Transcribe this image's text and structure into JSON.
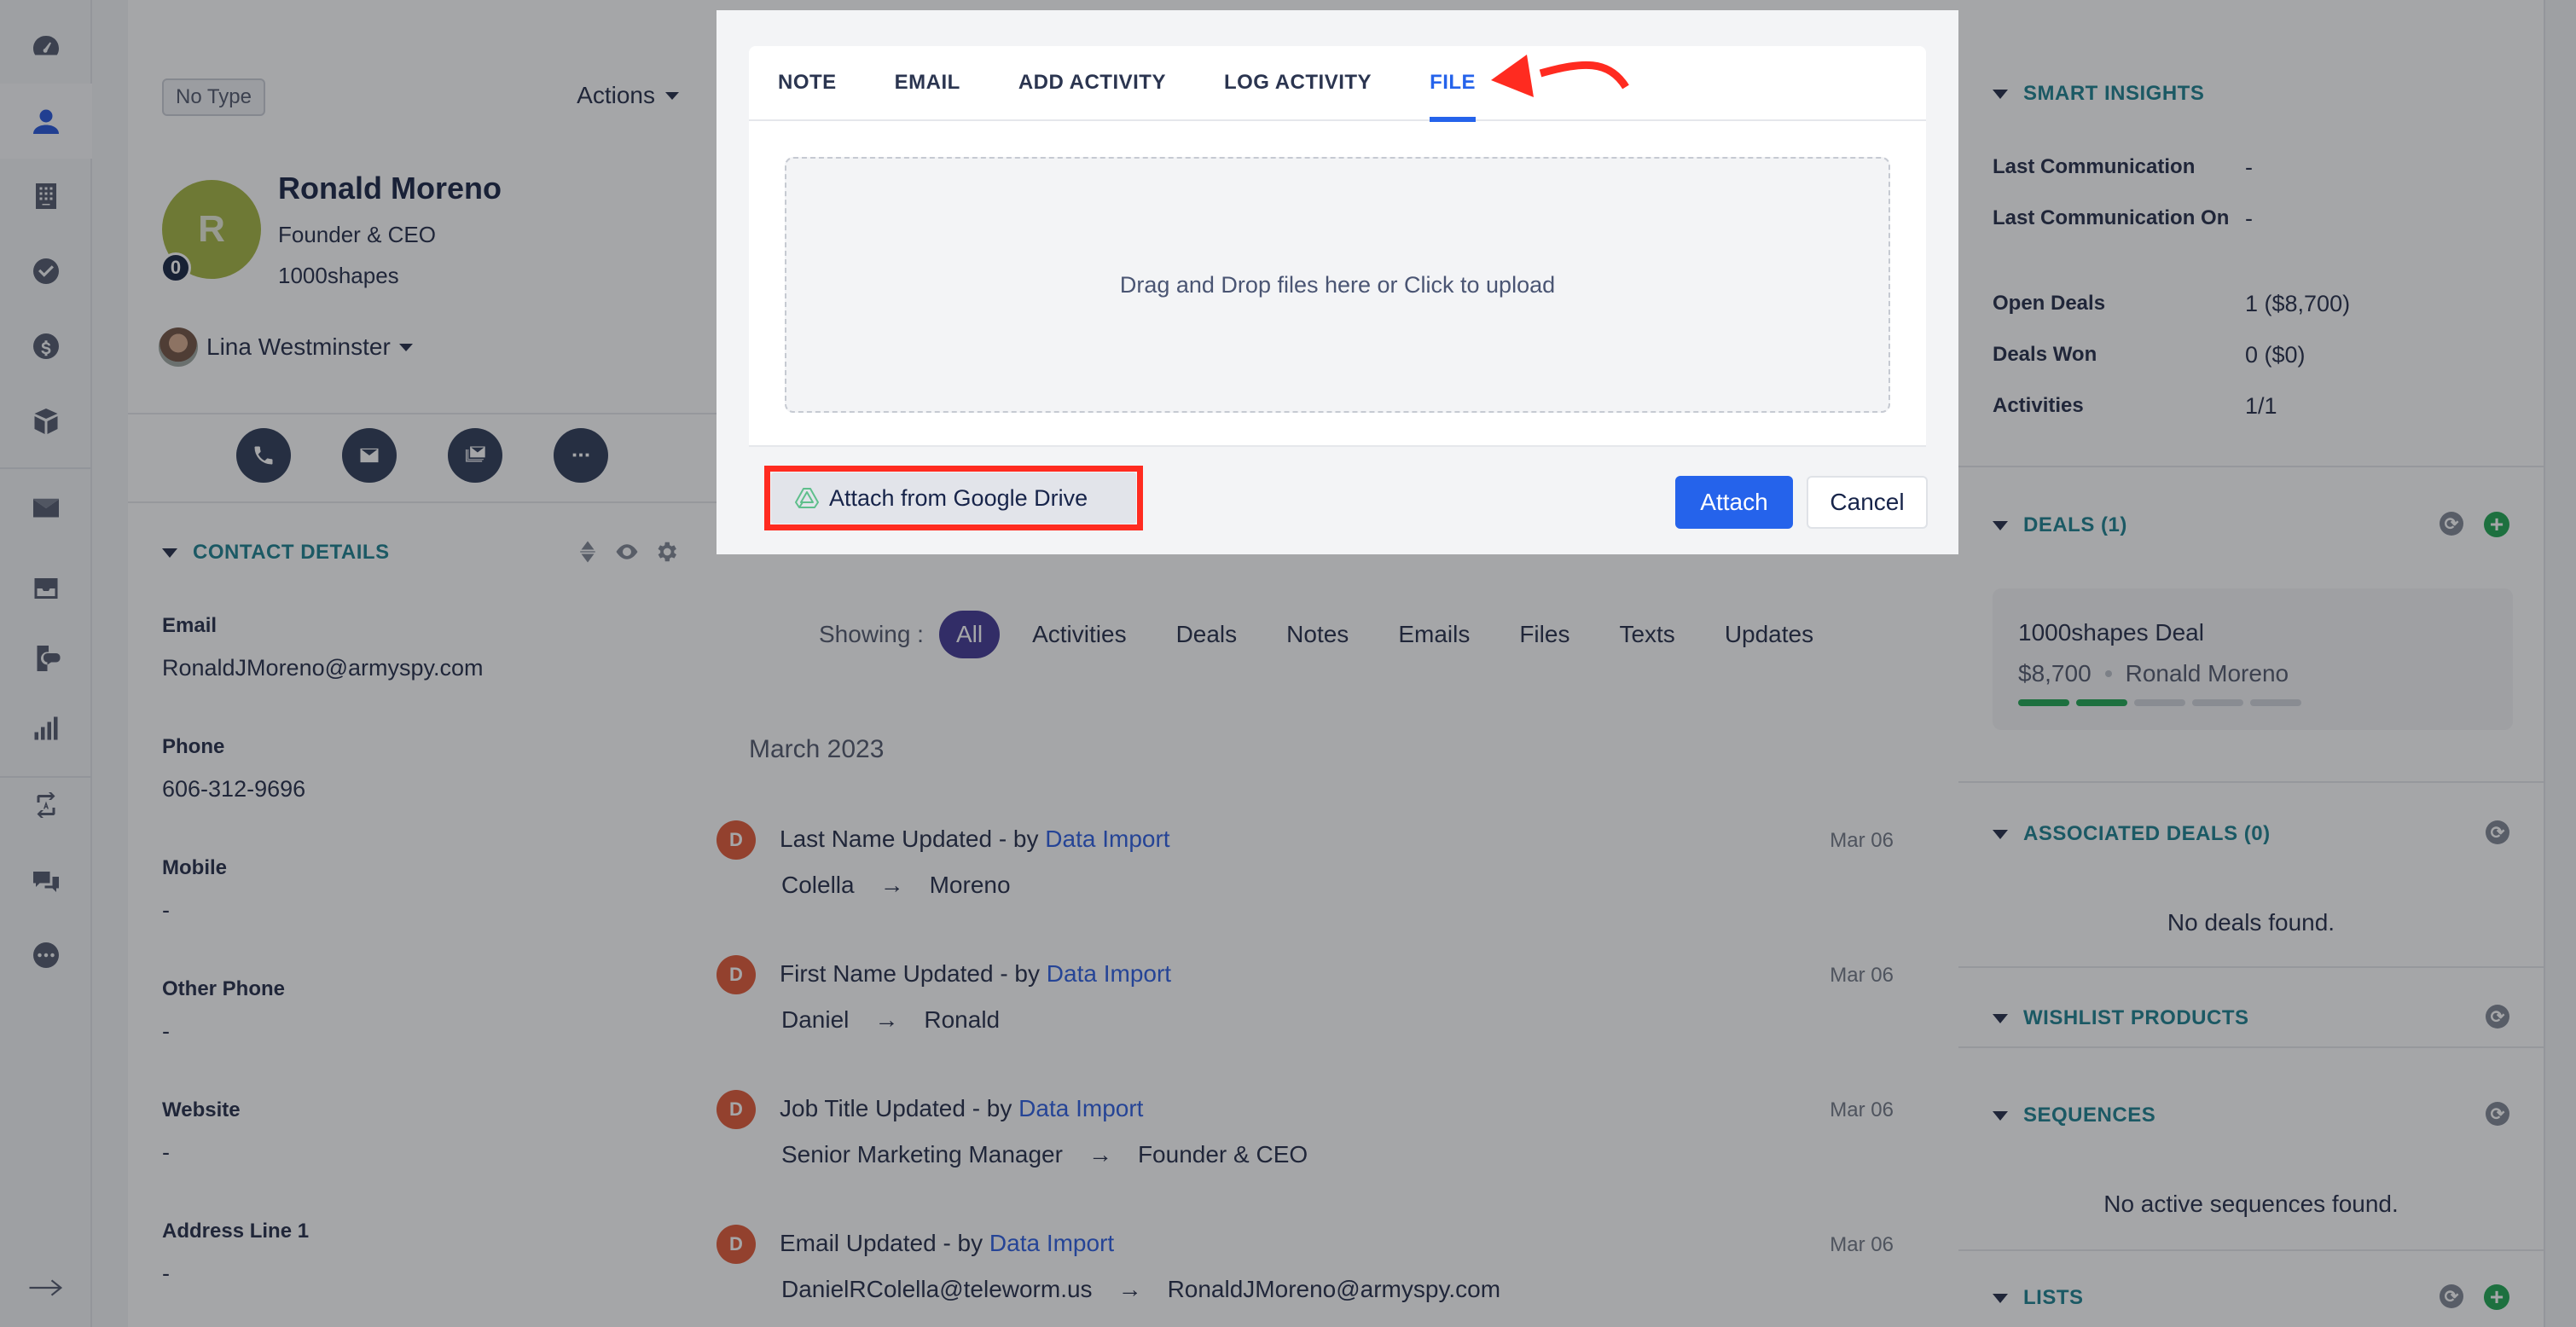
{
  "nav": {
    "items": [
      {
        "name": "dashboard",
        "icon": "speedometer-icon",
        "active": false
      },
      {
        "name": "contacts",
        "icon": "person-icon",
        "active": true
      },
      {
        "name": "companies",
        "icon": "building-icon",
        "active": false
      },
      {
        "name": "tasks",
        "icon": "check-circle-icon",
        "active": false
      },
      {
        "name": "deals",
        "icon": "dollar-circle-icon",
        "active": false
      },
      {
        "name": "products",
        "icon": "box-icon",
        "active": false
      },
      {
        "name": "email",
        "icon": "envelope-icon",
        "active": false
      },
      {
        "name": "inbox",
        "icon": "inbox-tray-icon",
        "active": false
      },
      {
        "name": "sms",
        "icon": "phone-chat-icon",
        "active": false
      },
      {
        "name": "reports",
        "icon": "bar-chart-icon",
        "active": false
      },
      {
        "name": "automation",
        "icon": "auto-cycle-icon",
        "active": false
      },
      {
        "name": "chat",
        "icon": "chat-bubbles-icon",
        "active": false
      },
      {
        "name": "more",
        "icon": "more-circle-icon",
        "active": false
      }
    ],
    "collapse_icon": "arrow-right-icon"
  },
  "contact": {
    "type_badge": "No Type",
    "actions_label": "Actions",
    "avatar_initial": "R",
    "avatar_color": "#a1b13a",
    "score": "0",
    "name": "Ronald Moreno",
    "title": "Founder & CEO",
    "company": "1000shapes",
    "owner": "Lina Westminster",
    "quick_actions": [
      "call",
      "email",
      "bulk-email",
      "more"
    ],
    "details_heading": "CONTACT DETAILS",
    "fields": [
      {
        "label": "Email",
        "value": "RonaldJMoreno@armyspy.com"
      },
      {
        "label": "Phone",
        "value": "606-312-9696"
      },
      {
        "label": "Mobile",
        "value": "-"
      },
      {
        "label": "Other Phone",
        "value": "-"
      },
      {
        "label": "Website",
        "value": "-"
      },
      {
        "label": "Address Line 1",
        "value": "-"
      }
    ]
  },
  "modal": {
    "tabs": [
      {
        "label": "NOTE",
        "active": false
      },
      {
        "label": "EMAIL",
        "active": false
      },
      {
        "label": "ADD ACTIVITY",
        "active": false
      },
      {
        "label": "LOG ACTIVITY",
        "active": false
      },
      {
        "label": "FILE",
        "active": true
      }
    ],
    "dropzone_text": "Drag and Drop files here or Click to upload",
    "gdrive_label": "Attach from Google Drive",
    "attach_label": "Attach",
    "cancel_label": "Cancel",
    "annotation_color": "#ff2b20"
  },
  "timeline": {
    "showing_label": "Showing :",
    "filters": [
      {
        "label": "All",
        "active": true
      },
      {
        "label": "Activities",
        "active": false
      },
      {
        "label": "Deals",
        "active": false
      },
      {
        "label": "Notes",
        "active": false
      },
      {
        "label": "Emails",
        "active": false
      },
      {
        "label": "Files",
        "active": false
      },
      {
        "label": "Texts",
        "active": false
      },
      {
        "label": "Updates",
        "active": false
      }
    ],
    "month": "March 2023",
    "items": [
      {
        "initial": "D",
        "title": "Last Name Updated",
        "by": "- by",
        "author": "Data Import",
        "date": "Mar 06",
        "from": "Colella",
        "arrow": "→",
        "to": "Moreno"
      },
      {
        "initial": "D",
        "title": "First Name Updated",
        "by": "- by",
        "author": "Data Import",
        "date": "Mar 06",
        "from": "Daniel",
        "arrow": "→",
        "to": "Ronald"
      },
      {
        "initial": "D",
        "title": "Job Title Updated",
        "by": "- by",
        "author": "Data Import",
        "date": "Mar 06",
        "from": "Senior Marketing Manager",
        "arrow": "→",
        "to": "Founder & CEO"
      },
      {
        "initial": "D",
        "title": "Email Updated",
        "by": "- by",
        "author": "Data Import",
        "date": "Mar 06",
        "from": "DanielRColella@teleworm.us",
        "arrow": "→",
        "to": "RonaldJMoreno@armyspy.com"
      }
    ]
  },
  "sidebar": {
    "smart_insights": {
      "heading": "SMART INSIGHTS",
      "rows": [
        {
          "label": "Last Communication",
          "value": "-"
        },
        {
          "label": "Last Communication On",
          "value": "-"
        },
        {
          "label": "Open Deals",
          "value": "1 ($8,700)"
        },
        {
          "label": "Deals Won",
          "value": "0 ($0)"
        },
        {
          "label": "Activities",
          "value": "1/1"
        }
      ]
    },
    "deals": {
      "heading": "DEALS (1)",
      "card": {
        "name": "1000shapes Deal",
        "amount": "$8,700",
        "contact": "Ronald Moreno",
        "stages_total": 5,
        "stages_done": 2
      }
    },
    "associated_deals": {
      "heading": "ASSOCIATED DEALS (0)",
      "empty": "No deals found."
    },
    "wishlist": {
      "heading": "WISHLIST PRODUCTS"
    },
    "sequences": {
      "heading": "SEQUENCES",
      "empty": "No active sequences found."
    },
    "lists": {
      "heading": "LISTS"
    }
  }
}
